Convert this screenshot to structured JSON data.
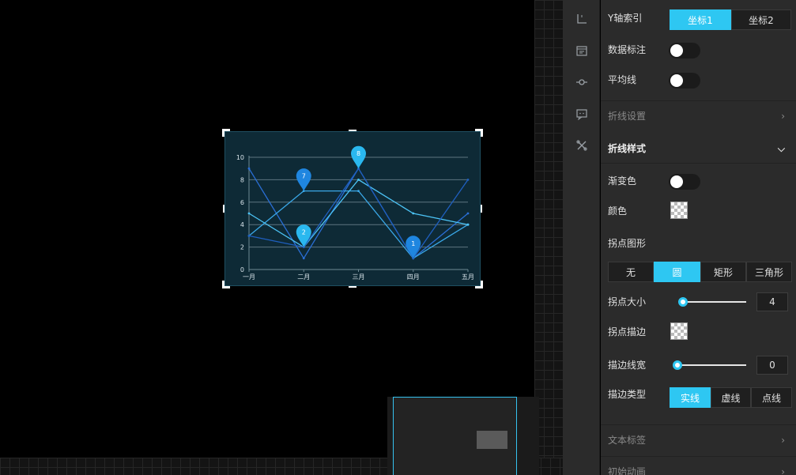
{
  "colors": {
    "accent": "#2ec7f2",
    "panel_bg": "#2b2b2b",
    "chart_bg": "#0e2a36"
  },
  "iconbar": {
    "icons": [
      "axis-icon",
      "calendar-icon",
      "line-point-icon",
      "comment-icon",
      "tools-icon"
    ]
  },
  "panel": {
    "y_axis_index": {
      "label": "Y轴索引",
      "options": [
        "坐标1",
        "坐标2"
      ],
      "selected": "坐标1"
    },
    "data_label": {
      "label": "数据标注",
      "on": false
    },
    "average_line": {
      "label": "平均线",
      "on": false
    },
    "line_settings": {
      "label": "折线设置"
    },
    "line_style": {
      "label": "折线样式"
    },
    "gradient": {
      "label": "渐变色",
      "on": false
    },
    "color": {
      "label": "颜色"
    },
    "point_shape": {
      "label": "拐点图形",
      "options": [
        "无",
        "圆",
        "矩形",
        "三角形"
      ],
      "selected": "圆"
    },
    "point_size": {
      "label": "拐点大小",
      "value": "4"
    },
    "point_stroke": {
      "label": "拐点描边"
    },
    "stroke_width": {
      "label": "描边线宽",
      "value": "0"
    },
    "stroke_type": {
      "label": "描边类型",
      "options": [
        "实线",
        "虚线",
        "点线"
      ],
      "selected": "实线"
    },
    "text_label": {
      "label": "文本标签"
    },
    "initial_animation": {
      "label": "初始动画"
    }
  },
  "chart_data": {
    "type": "line",
    "categories": [
      "一月",
      "二月",
      "三月",
      "四月",
      "五月"
    ],
    "ylim": [
      0,
      10
    ],
    "yticks": [
      "0",
      "2",
      "4",
      "6",
      "8",
      "10"
    ],
    "series": [
      {
        "values": [
          9,
          1,
          9,
          1,
          5
        ],
        "color": "#2a6fd6"
      },
      {
        "values": [
          3,
          7,
          7,
          1,
          4
        ],
        "color": "#3aa8e8"
      },
      {
        "values": [
          5,
          2,
          8,
          5,
          4
        ],
        "color": "#4cc3f5"
      },
      {
        "values": [
          3,
          2,
          9,
          1,
          8
        ],
        "color": "#1f5fbf"
      }
    ],
    "markers": [
      {
        "label": "7",
        "x": "二月",
        "y": 7,
        "color": "#1f86e0"
      },
      {
        "label": "2",
        "x": "二月",
        "y": 2,
        "color": "#2ab8ef"
      },
      {
        "label": "8",
        "x": "三月",
        "y": 9,
        "color": "#2ab8ef"
      },
      {
        "label": "1",
        "x": "四月",
        "y": 1,
        "color": "#1f86e0"
      }
    ]
  }
}
